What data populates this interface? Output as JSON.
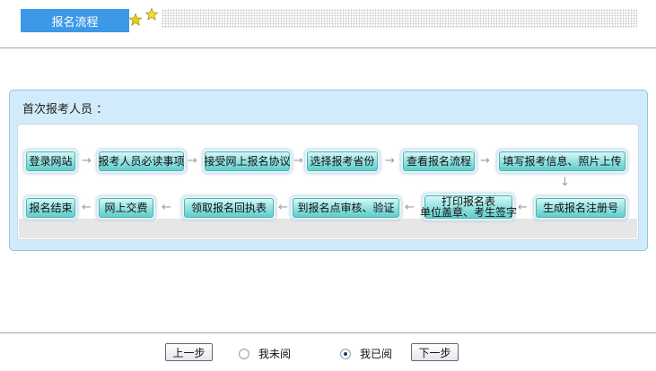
{
  "header": {
    "title": "报名流程",
    "star_colors": [
      "#e8d21c",
      "#f1dd3a"
    ]
  },
  "panel": {
    "title": "首次报考人员 ："
  },
  "steps": {
    "row1": [
      "登录网站",
      "报考人员必读事项",
      "接受网上报名协议",
      "选择报考省份",
      "查看报名流程",
      "填写报考信息、照片上传"
    ],
    "row2": [
      "报名结束",
      "网上交费",
      "领取报名回执表",
      "到报名点审核、验证",
      "打印报名表",
      "单位盖章、考生签字",
      "生成报名注册号"
    ]
  },
  "icons": {
    "arrow_right": "→",
    "arrow_left": "←",
    "arrow_down": "↓"
  },
  "footer": {
    "prev_label": "上一步",
    "unread_label": "我未阅",
    "read_label": "我已阅",
    "next_label": "下一步",
    "read_selected": true
  }
}
